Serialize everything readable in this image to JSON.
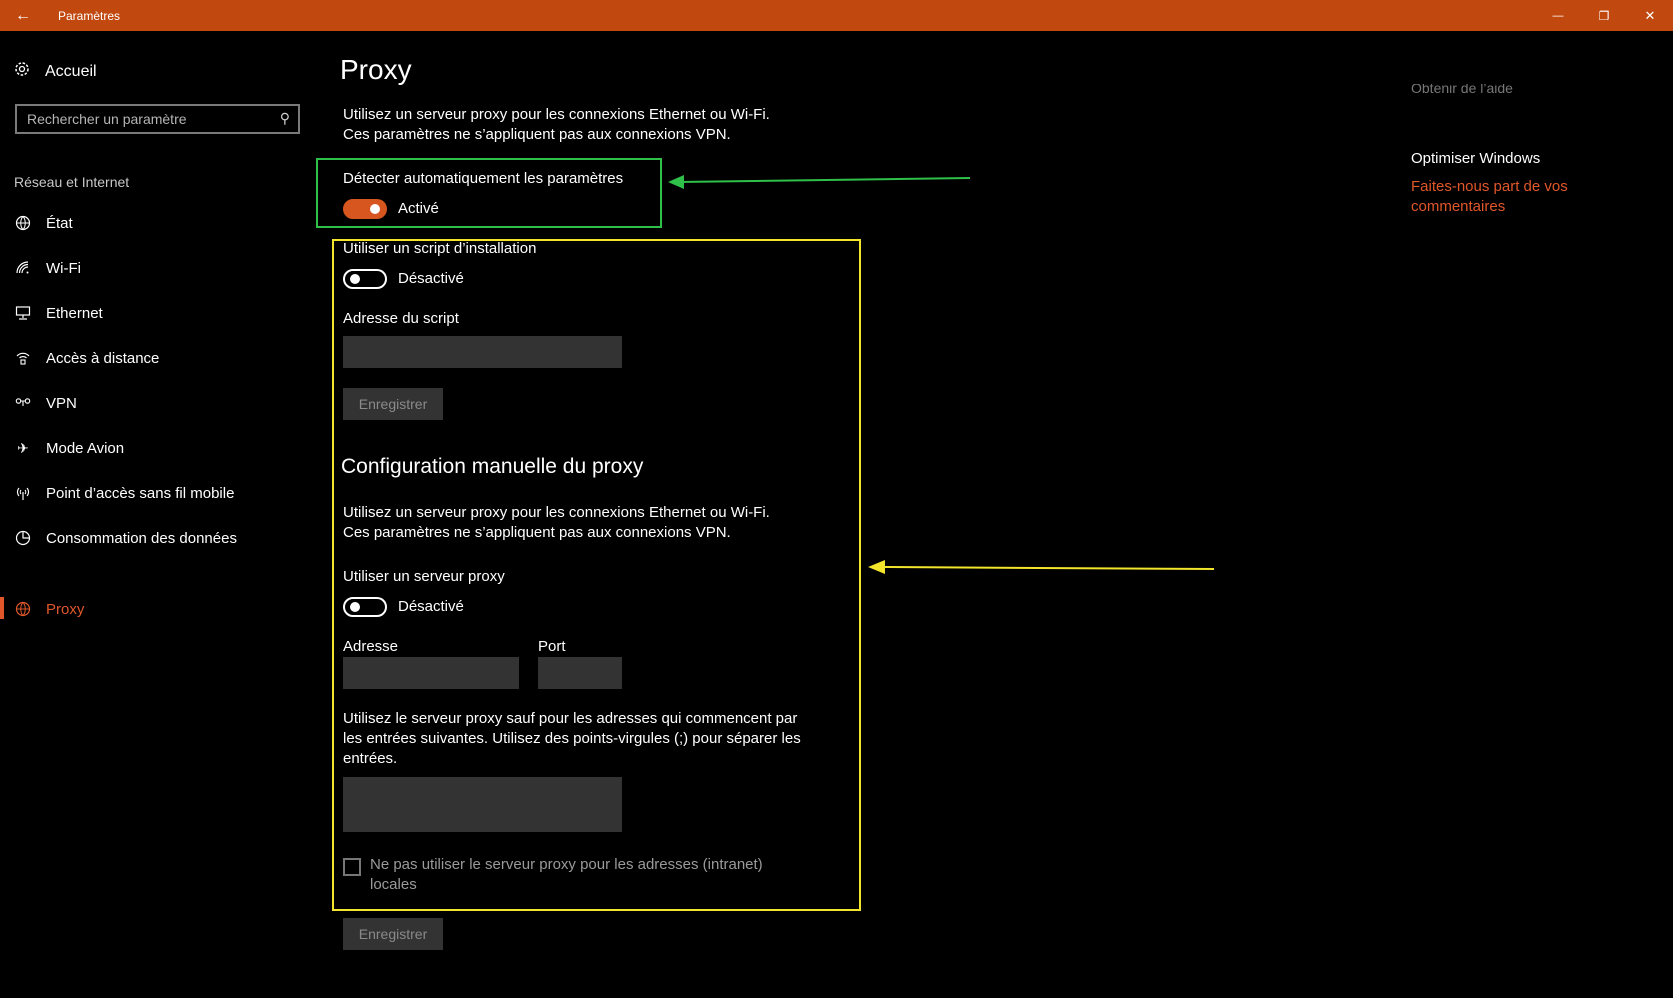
{
  "titlebar": {
    "back_glyph": "←",
    "title": "Paramètres",
    "minimize_glyph": "—",
    "restore_glyph": "❐",
    "close_glyph": "✕",
    "color": "#c1480f"
  },
  "sidebar": {
    "home_label": "Accueil",
    "search_placeholder": "Rechercher un paramètre",
    "section_label": "Réseau et Internet",
    "items": [
      {
        "label": "État",
        "icon": "globe-status-icon"
      },
      {
        "label": "Wi-Fi",
        "icon": "wifi-icon"
      },
      {
        "label": "Ethernet",
        "icon": "ethernet-icon"
      },
      {
        "label": "Accès à distance",
        "icon": "dialup-icon"
      },
      {
        "label": "VPN",
        "icon": "vpn-icon"
      },
      {
        "label": "Mode Avion",
        "icon": "airplane-icon"
      },
      {
        "label": "Point d’accès sans fil mobile",
        "icon": "hotspot-icon"
      },
      {
        "label": "Consommation des données",
        "icon": "data-usage-icon"
      },
      {
        "label": "Proxy",
        "icon": "globe-icon",
        "active": true
      }
    ],
    "accent_color": "#e0572a"
  },
  "main": {
    "title": "Proxy",
    "intro_line1": "Utilisez un serveur proxy pour les connexions Ethernet ou Wi-Fi.",
    "intro_line2": "Ces paramètres ne s’appliquent pas aux connexions VPN.",
    "auto_detect": {
      "label": "Détecter automatiquement les paramètres",
      "state": "Activé",
      "on": true
    },
    "script": {
      "label": "Utiliser un script d’installation",
      "state": "Désactivé",
      "on": false
    },
    "script_address": {
      "label": "Adresse du script",
      "value": ""
    },
    "save_label_1": "Enregistrer",
    "manual_title": "Configuration manuelle du proxy",
    "manual_line1": "Utilisez un serveur proxy pour les connexions Ethernet ou Wi-Fi.",
    "manual_line2": "Ces paramètres ne s’appliquent pas aux connexions VPN.",
    "use_proxy": {
      "label": "Utiliser un serveur proxy",
      "state": "Désactivé",
      "on": false
    },
    "address_label": "Adresse",
    "port_label": "Port",
    "exceptions_line1": "Utilisez le serveur proxy sauf pour les adresses qui commencent par",
    "exceptions_line2": "les entrées suivantes. Utilisez des points-virgules (;) pour séparer les",
    "exceptions_line3": "entrées.",
    "local_checkbox_line1": "Ne pas utiliser le serveur proxy pour les adresses (intranet)",
    "local_checkbox_line2": "locales",
    "save_label_2": "Enregistrer",
    "toggle_on_color": "#d7561f"
  },
  "right": {
    "truncated_top": "Obtenir de l’aide",
    "heading": "Optimiser Windows",
    "feedback_link": "Faites-nous part de vos commentaires"
  },
  "annotations": {
    "green_color": "#2fc04a",
    "yellow_color": "#f2e52c"
  }
}
